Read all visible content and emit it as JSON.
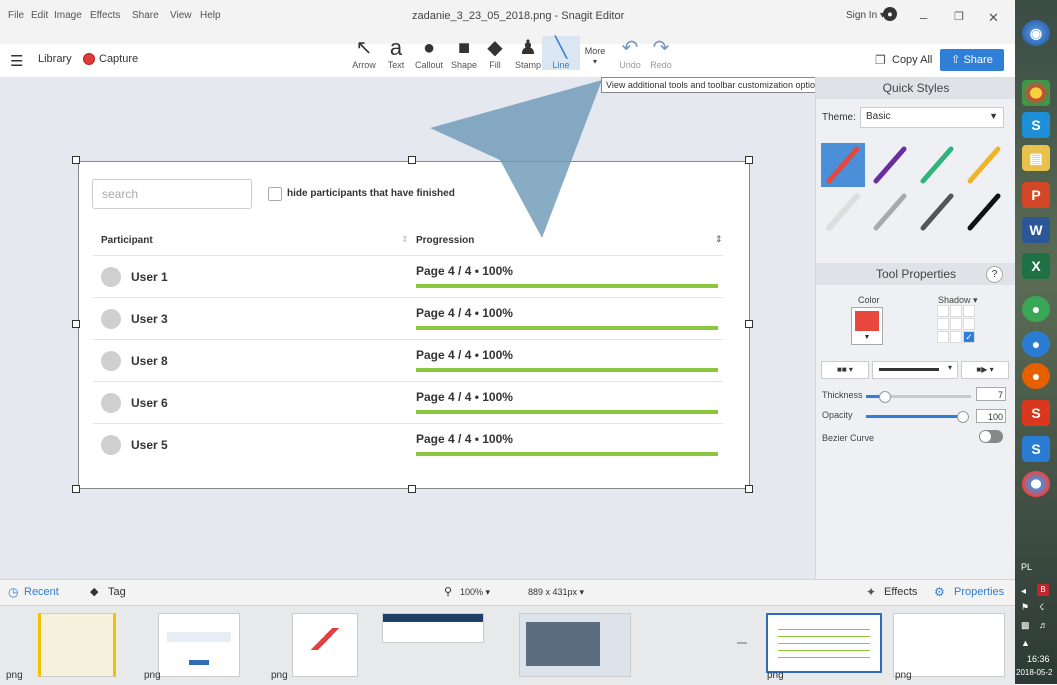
{
  "window": {
    "title": "zadanie_3_23_05_2018.png - Snagit Editor",
    "menu": [
      "File",
      "Edit",
      "Image",
      "Effects",
      "Share",
      "View",
      "Help"
    ],
    "sign_in": "Sign In ▾"
  },
  "toolbar": {
    "library": "Library",
    "capture": "Capture",
    "tools": [
      {
        "label": "Arrow",
        "icon": "↖"
      },
      {
        "label": "Text",
        "icon": "a"
      },
      {
        "label": "Callout",
        "icon": "●"
      },
      {
        "label": "Shape",
        "icon": "■"
      },
      {
        "label": "Fill",
        "icon": "◆"
      },
      {
        "label": "Stamp",
        "icon": "♟"
      },
      {
        "label": "Line",
        "icon": "╲"
      }
    ],
    "more": "More",
    "undo": "Undo",
    "redo": "Redo",
    "copy_all": "Copy All",
    "share": "Share",
    "tooltip": "View additional tools and toolbar customization options."
  },
  "document": {
    "search_placeholder": "search",
    "hide_label": "hide participants that have finished",
    "col_participant": "Participant",
    "col_progression": "Progression",
    "rows": [
      {
        "user": "User 1",
        "progress": "Page 4 / 4  •  100%",
        "fraction": 1.0
      },
      {
        "user": "User 3",
        "progress": "Page 4 / 4  •  100%",
        "fraction": 1.0
      },
      {
        "user": "User 8",
        "progress": "Page 4 / 4  •  100%",
        "fraction": 1.0
      },
      {
        "user": "User 6",
        "progress": "Page 4 / 4  •  100%",
        "fraction": 1.0
      },
      {
        "user": "User 5",
        "progress": "Page 4 / 4  •  100%",
        "fraction": 1.0
      }
    ]
  },
  "quick_styles": {
    "title": "Quick Styles",
    "theme_label": "Theme:",
    "theme_value": "Basic",
    "swatch_colors": [
      "#e8473d",
      "#6a2da0",
      "#2fb57a",
      "#f0b429",
      "#f2f2f2",
      "#a9a9a9",
      "#555555",
      "#111111"
    ]
  },
  "tool_properties": {
    "title": "Tool Properties",
    "help": "?",
    "color_label": "Color",
    "color_value": "#e8473d",
    "shadow_label": "Shadow ▾",
    "thickness_label": "Thickness",
    "thickness_value": "7",
    "opacity_label": "Opacity",
    "opacity_value": "100",
    "bezier_label": "Bezier Curve"
  },
  "bottom": {
    "recent": "Recent",
    "tag": "Tag",
    "zoom": "100% ▾",
    "dimensions": "889 x 431px ▾",
    "effects": "Effects",
    "properties": "Properties"
  },
  "tray": {
    "label": "png"
  },
  "taskbar": {
    "lang": "PL",
    "time": "16:36",
    "date": "2018-05-2"
  }
}
